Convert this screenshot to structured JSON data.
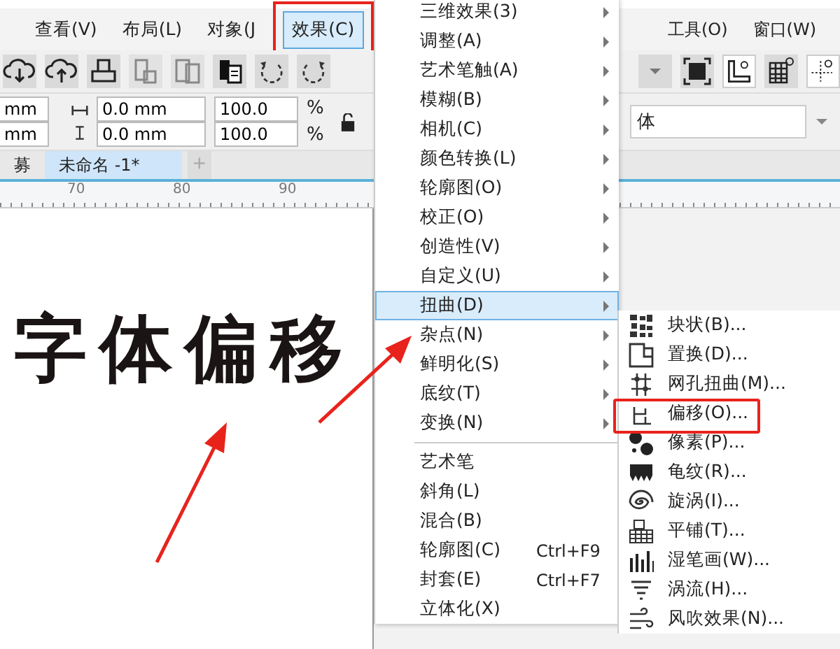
{
  "menu_bar": {
    "items": [
      {
        "label": "查看(V)",
        "selected": false
      },
      {
        "label": "布局(L)",
        "selected": false
      },
      {
        "label": "对象(J",
        "selected": false
      },
      {
        "label": "效果(C)",
        "selected": true
      },
      {
        "label": "工具(O)",
        "selected": false
      },
      {
        "label": "窗口(W)",
        "selected": false
      }
    ]
  },
  "property_bar": {
    "position_fields": [
      "mm",
      "mm"
    ],
    "size_fields": [
      "0.0 mm",
      "0.0 mm"
    ],
    "scale_fields": [
      "100.0",
      "100.0"
    ],
    "percent_signs": [
      "%",
      "%"
    ],
    "font_field": "体"
  },
  "document_tabs": [
    {
      "label": "募",
      "selected": false
    },
    {
      "label": "未命名 -1*",
      "selected": true
    }
  ],
  "new_tab_button": "+",
  "ruler": {
    "labels": [
      "70",
      "80",
      "90"
    ]
  },
  "canvas_text": "字体偏移",
  "effects_menu": {
    "sections": [
      [
        {
          "label": "三维效果(3)",
          "kind": "submenu",
          "selected": false
        },
        {
          "label": "调整(A)",
          "kind": "submenu",
          "selected": false
        },
        {
          "label": "艺术笔触(A)",
          "kind": "submenu",
          "selected": false
        },
        {
          "label": "模糊(B)",
          "kind": "submenu",
          "selected": false
        },
        {
          "label": "相机(C)",
          "kind": "submenu",
          "selected": false
        },
        {
          "label": "颜色转换(L)",
          "kind": "submenu",
          "selected": false
        },
        {
          "label": "轮廓图(O)",
          "kind": "submenu",
          "selected": false
        },
        {
          "label": "校正(O)",
          "kind": "submenu",
          "selected": false
        },
        {
          "label": "创造性(V)",
          "kind": "submenu",
          "selected": false
        },
        {
          "label": "自定义(U)",
          "kind": "submenu",
          "selected": false
        },
        {
          "label": "扭曲(D)",
          "kind": "submenu",
          "selected": true
        },
        {
          "label": "杂点(N)",
          "kind": "submenu",
          "selected": false
        },
        {
          "label": "鲜明化(S)",
          "kind": "submenu",
          "selected": false
        },
        {
          "label": "底纹(T)",
          "kind": "submenu",
          "selected": false
        },
        {
          "label": "变换(N)",
          "kind": "submenu",
          "selected": false
        }
      ],
      [
        {
          "label": "艺术笔",
          "kind": "command",
          "selected": false
        },
        {
          "label": "斜角(L)",
          "kind": "command",
          "selected": false
        },
        {
          "label": "混合(B)",
          "kind": "command",
          "selected": false
        },
        {
          "label": "轮廓图(C)",
          "kind": "command",
          "shortcut": "Ctrl+F9",
          "selected": false
        },
        {
          "label": "封套(E)",
          "kind": "command",
          "shortcut": "Ctrl+F7",
          "selected": false
        },
        {
          "label": "立体化(X)",
          "kind": "command",
          "selected": false
        }
      ]
    ]
  },
  "distort_submenu": {
    "items": [
      {
        "label": "块状(B)..."
      },
      {
        "label": "置换(D)..."
      },
      {
        "label": "网孔扭曲(M)..."
      },
      {
        "label": "偏移(O)..."
      },
      {
        "label": "像素(P)..."
      },
      {
        "label": "龟纹(R)..."
      },
      {
        "label": "旋涡(I)..."
      },
      {
        "label": "平铺(T)..."
      },
      {
        "label": "湿笔画(W)..."
      },
      {
        "label": "涡流(H)..."
      },
      {
        "label": "风吹效果(N)..."
      }
    ]
  }
}
